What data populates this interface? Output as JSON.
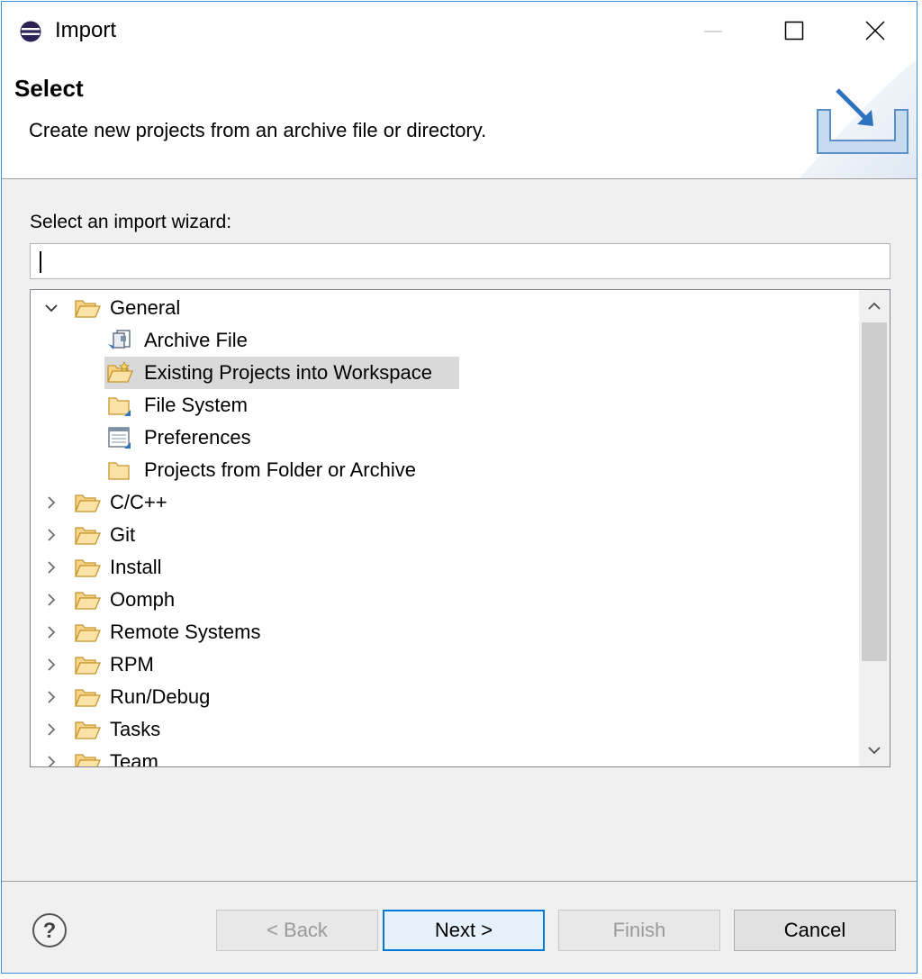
{
  "window": {
    "title": "Import"
  },
  "header": {
    "title": "Select",
    "description": "Create new projects from an archive file or directory."
  },
  "wizard_picker": {
    "label": "Select an import wizard:",
    "filter_value": ""
  },
  "tree": {
    "items": [
      {
        "label": "General",
        "level": 0,
        "expanded": true,
        "icon": "folder-open-icon"
      },
      {
        "label": "Archive File",
        "level": 1,
        "icon": "archive-file-icon"
      },
      {
        "label": "Existing Projects into Workspace",
        "level": 1,
        "icon": "existing-projects-icon",
        "selected": true
      },
      {
        "label": "File System",
        "level": 1,
        "icon": "folder-icon"
      },
      {
        "label": "Preferences",
        "level": 1,
        "icon": "preferences-icon"
      },
      {
        "label": "Projects from Folder or Archive",
        "level": 1,
        "icon": "folder-icon"
      },
      {
        "label": "C/C++",
        "level": 0,
        "expanded": false,
        "icon": "folder-open-icon"
      },
      {
        "label": "Git",
        "level": 0,
        "expanded": false,
        "icon": "folder-open-icon"
      },
      {
        "label": "Install",
        "level": 0,
        "expanded": false,
        "icon": "folder-open-icon"
      },
      {
        "label": "Oomph",
        "level": 0,
        "expanded": false,
        "icon": "folder-open-icon"
      },
      {
        "label": "Remote Systems",
        "level": 0,
        "expanded": false,
        "icon": "folder-open-icon"
      },
      {
        "label": "RPM",
        "level": 0,
        "expanded": false,
        "icon": "folder-open-icon"
      },
      {
        "label": "Run/Debug",
        "level": 0,
        "expanded": false,
        "icon": "folder-open-icon"
      },
      {
        "label": "Tasks",
        "level": 0,
        "expanded": false,
        "icon": "folder-open-icon"
      },
      {
        "label": "Team",
        "level": 0,
        "expanded": false,
        "icon": "folder-open-icon"
      }
    ]
  },
  "buttons": {
    "back": "< Back",
    "next": "Next >",
    "finish": "Finish",
    "cancel": "Cancel"
  },
  "colors": {
    "accent": "#0078d7",
    "selection": "#d9d9d9",
    "window_border": "#3c8fd8"
  }
}
